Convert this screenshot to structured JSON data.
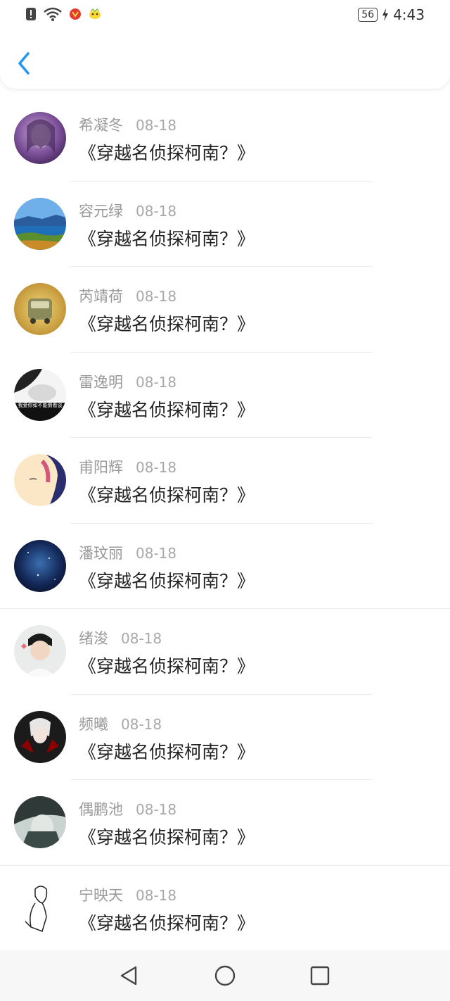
{
  "status_bar": {
    "battery": "56",
    "time": "4:43",
    "icons": [
      "alert-icon",
      "wifi-icon",
      "app-notification-icon",
      "app-notification-icon-2",
      "charging-icon"
    ]
  },
  "header": {
    "back_icon": "chevron-left-icon",
    "accent": "#2196F3"
  },
  "items": [
    {
      "name": "希凝冬",
      "date": "08-18",
      "message": "《穿越名侦探柯南？》"
    },
    {
      "name": "容元绿",
      "date": "08-18",
      "message": "《穿越名侦探柯南？》"
    },
    {
      "name": "芮靖荷",
      "date": "08-18",
      "message": "《穿越名侦探柯南？》"
    },
    {
      "name": "雷逸明",
      "date": "08-18",
      "message": "《穿越名侦探柯南？》"
    },
    {
      "name": "甫阳辉",
      "date": "08-18",
      "message": "《穿越名侦探柯南？》"
    },
    {
      "name": "潘玟丽",
      "date": "08-18",
      "message": "《穿越名侦探柯南？》"
    },
    {
      "name": "绪浚",
      "date": "08-18",
      "message": "《穿越名侦探柯南？》"
    },
    {
      "name": "频曦",
      "date": "08-18",
      "message": "《穿越名侦探柯南？》"
    },
    {
      "name": "偶鹏池",
      "date": "08-18",
      "message": "《穿越名侦探柯南？》"
    },
    {
      "name": "宁映天",
      "date": "08-18",
      "message": "《穿越名侦探柯南？》"
    }
  ],
  "avatar_overlay_text": "我爱你如不能倒看谈",
  "nav_bar": {
    "icons": [
      "back-triangle-icon",
      "home-circle-icon",
      "recents-square-icon"
    ]
  }
}
